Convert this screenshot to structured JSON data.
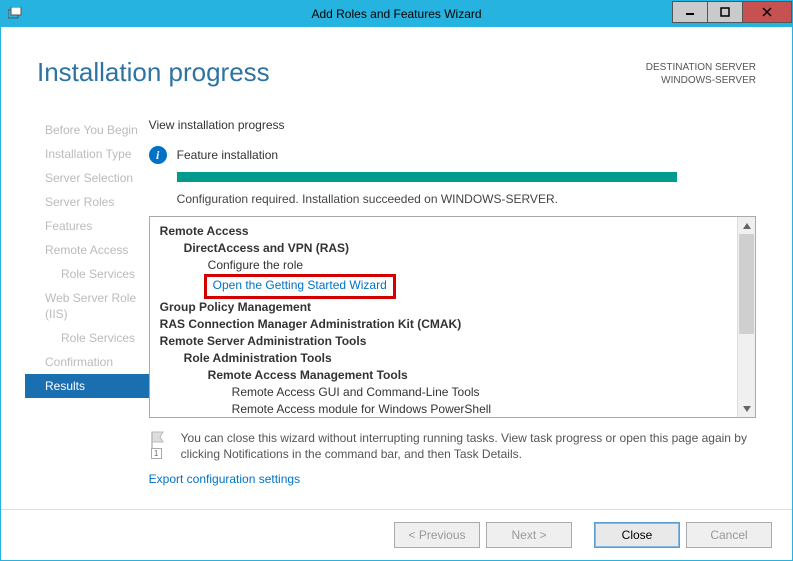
{
  "titlebar": {
    "title": "Add Roles and Features Wizard"
  },
  "header": {
    "heading": "Installation progress",
    "dest_label": "DESTINATION SERVER",
    "dest_value": "WINDOWS-SERVER"
  },
  "sidebar": {
    "items": [
      {
        "label": "Before You Begin",
        "indent": false
      },
      {
        "label": "Installation Type",
        "indent": false
      },
      {
        "label": "Server Selection",
        "indent": false
      },
      {
        "label": "Server Roles",
        "indent": false
      },
      {
        "label": "Features",
        "indent": false
      },
      {
        "label": "Remote Access",
        "indent": false
      },
      {
        "label": "Role Services",
        "indent": true
      },
      {
        "label": "Web Server Role (IIS)",
        "indent": false
      },
      {
        "label": "Role Services",
        "indent": true
      },
      {
        "label": "Confirmation",
        "indent": false
      },
      {
        "label": "Results",
        "indent": false,
        "active": true
      }
    ]
  },
  "main": {
    "view_label": "View installation progress",
    "status_heading": "Feature installation",
    "status_text": "Configuration required. Installation succeeded on WINDOWS-SERVER.",
    "features": {
      "l0_remote_access": "Remote Access",
      "l1_direct": "DirectAccess and VPN (RAS)",
      "l2_configure": "Configure the role",
      "l2_open_wizard": "Open the Getting Started Wizard",
      "l0_gpm": "Group Policy Management",
      "l0_ras_cmak": "RAS Connection Manager Administration Kit (CMAK)",
      "l0_rsat": "Remote Server Administration Tools",
      "l1_rat": "Role Administration Tools",
      "l2_ramt": "Remote Access Management Tools",
      "l3_ragui": "Remote Access GUI and Command-Line Tools",
      "l3_raps": "Remote Access module for Windows PowerShell"
    },
    "note_text": "You can close this wizard without interrupting running tasks. View task progress or open this page again by clicking Notifications in the command bar, and then Task Details.",
    "export_link": "Export configuration settings"
  },
  "footer": {
    "previous": "< Previous",
    "next": "Next >",
    "close": "Close",
    "cancel": "Cancel"
  }
}
